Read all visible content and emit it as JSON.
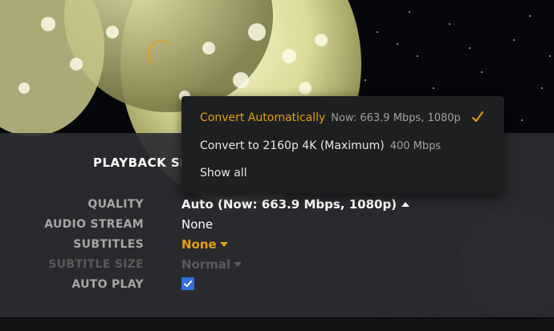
{
  "colors": {
    "accent": "#e5a00d",
    "panel_bg": "#2c2e31",
    "dropdown_bg": "#1e1f21",
    "checkbox_blue": "#2f6fe0"
  },
  "video": {
    "loading_icon": "spinner-icon"
  },
  "settings": {
    "title": "PLAYBACK SE",
    "rows": [
      {
        "label": "QUALITY",
        "value": "Auto (Now: 663.9 Mbps, 1080p)"
      },
      {
        "label": "AUDIO STREAM",
        "value": "None"
      },
      {
        "label": "SUBTITLES",
        "value": "None"
      },
      {
        "label": "SUBTITLE SIZE",
        "value": "Normal"
      },
      {
        "label": "AUTO PLAY",
        "checked": true
      }
    ]
  },
  "quality_dropdown": {
    "options": [
      {
        "label": "Convert Automatically",
        "meta": "Now: 663.9 Mbps, 1080p",
        "selected": true
      },
      {
        "label": "Convert to 2160p 4K (Maximum)",
        "meta": "400 Mbps",
        "selected": false
      },
      {
        "label": "Show all",
        "meta": "",
        "selected": false
      }
    ],
    "selected_icon": "checkmark-icon"
  }
}
